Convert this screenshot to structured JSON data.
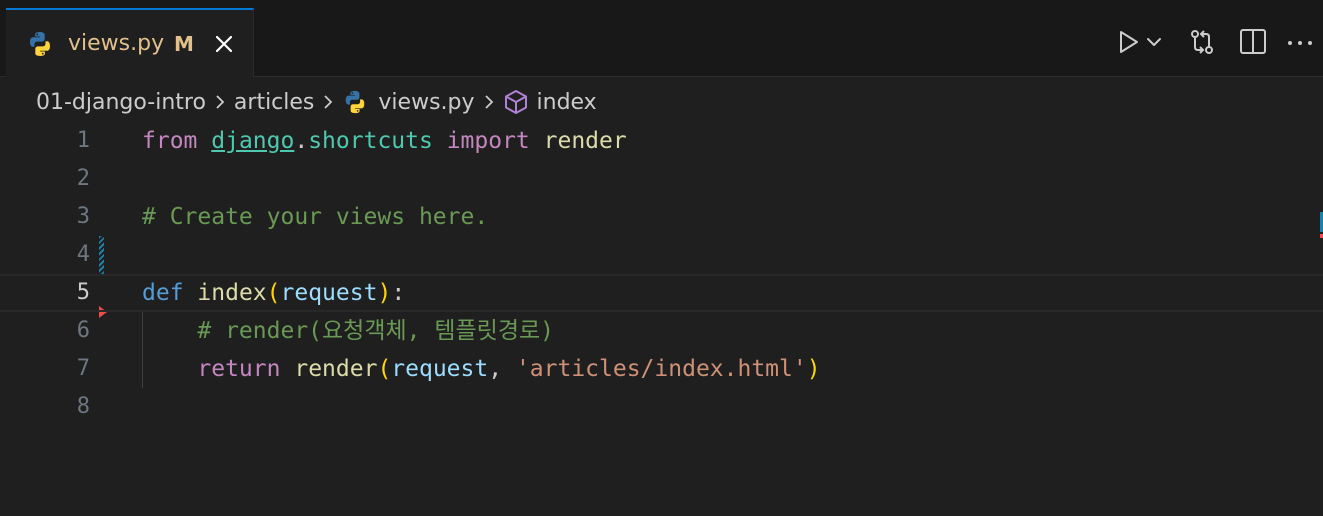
{
  "tab": {
    "title": "views.py",
    "status": "M",
    "icon": "python-icon"
  },
  "actions": [
    {
      "name": "run-button",
      "icon": "play-icon"
    },
    {
      "name": "run-dropdown-button",
      "icon": "chevron-down-icon"
    },
    {
      "name": "open-changes-button",
      "icon": "git-compare-icon"
    },
    {
      "name": "split-editor-button",
      "icon": "split-editor-icon"
    },
    {
      "name": "more-actions-button",
      "icon": "ellipsis-icon"
    }
  ],
  "breadcrumb": {
    "folder": "01-django-intro",
    "subfolder": "articles",
    "file": "views.py",
    "symbol": "index"
  },
  "editor": {
    "active_line": 5,
    "line_numbers": [
      "1",
      "2",
      "3",
      "4",
      "5",
      "6",
      "7",
      "8"
    ],
    "lines": [
      {
        "n": 1,
        "tokens": [
          {
            "t": "from",
            "c": "kw-ctrl"
          },
          {
            "t": " ",
            "c": "punc"
          },
          {
            "t": "django",
            "c": "mod-ul"
          },
          {
            "t": ".",
            "c": "punc"
          },
          {
            "t": "shortcuts",
            "c": "mod"
          },
          {
            "t": " ",
            "c": "punc"
          },
          {
            "t": "import",
            "c": "kw-ctrl"
          },
          {
            "t": " ",
            "c": "punc"
          },
          {
            "t": "render",
            "c": "fn"
          }
        ]
      },
      {
        "n": 2,
        "tokens": []
      },
      {
        "n": 3,
        "tokens": [
          {
            "t": "# Create your views here.",
            "c": "comment"
          }
        ]
      },
      {
        "n": 4,
        "tokens": []
      },
      {
        "n": 5,
        "tokens": [
          {
            "t": "def",
            "c": "kw"
          },
          {
            "t": " ",
            "c": "punc"
          },
          {
            "t": "index",
            "c": "fn"
          },
          {
            "t": "(",
            "c": "brk"
          },
          {
            "t": "request",
            "c": "param"
          },
          {
            "t": ")",
            "c": "brk"
          },
          {
            "t": ":",
            "c": "punc"
          }
        ]
      },
      {
        "n": 6,
        "tokens": [
          {
            "t": "    ",
            "c": "punc"
          },
          {
            "t": "# render(요청객체, 템플릿경로)",
            "c": "comment"
          }
        ]
      },
      {
        "n": 7,
        "tokens": [
          {
            "t": "    ",
            "c": "punc"
          },
          {
            "t": "return",
            "c": "kw-ctrl"
          },
          {
            "t": " ",
            "c": "punc"
          },
          {
            "t": "render",
            "c": "fn"
          },
          {
            "t": "(",
            "c": "brk"
          },
          {
            "t": "request",
            "c": "param"
          },
          {
            "t": ", ",
            "c": "punc"
          },
          {
            "t": "'articles/index.html'",
            "c": "str"
          },
          {
            "t": ")",
            "c": "brk"
          }
        ]
      },
      {
        "n": 8,
        "tokens": []
      }
    ]
  },
  "colors": {
    "tab_active_border": "#0078d4",
    "modified_text": "#e2c08d",
    "python_blue": "#3572a5",
    "python_yellow": "#ffd43b",
    "symbol_method": "#b180d7",
    "gutter_modified": "#1b81a8",
    "gutter_deleted": "#f14c4c"
  }
}
